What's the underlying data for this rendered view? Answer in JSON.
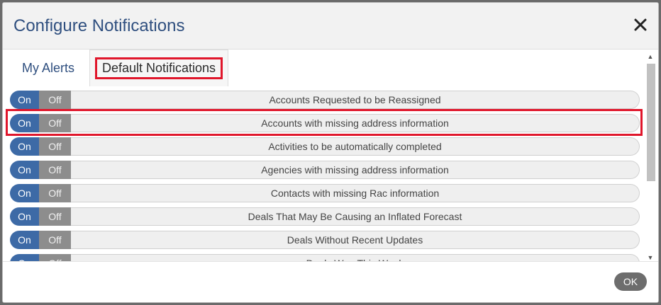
{
  "modal": {
    "title": "Configure Notifications",
    "close_icon": "close-icon"
  },
  "tabs": [
    {
      "label": "My Alerts",
      "active": false
    },
    {
      "label": "Default Notifications",
      "active": true
    }
  ],
  "toggle_labels": {
    "on": "On",
    "off": "Off"
  },
  "notifications": [
    {
      "label": "Accounts Requested to be Reassigned",
      "state": "On"
    },
    {
      "label": "Accounts with missing address information",
      "state": "On"
    },
    {
      "label": "Activities to be automatically completed",
      "state": "On"
    },
    {
      "label": "Agencies with missing address information",
      "state": "On"
    },
    {
      "label": "Contacts with missing Rac information",
      "state": "On"
    },
    {
      "label": "Deals That May Be Causing an Inflated Forecast",
      "state": "On"
    },
    {
      "label": "Deals Without Recent Updates",
      "state": "On"
    },
    {
      "label": "Deals Won This Week",
      "state": "On"
    }
  ],
  "footer": {
    "ok_label": "OK"
  },
  "colors": {
    "title": "#2f4f7f",
    "on_toggle": "#3d6aa6",
    "off_toggle": "#8d8d8d",
    "highlight": "#e0162b"
  }
}
